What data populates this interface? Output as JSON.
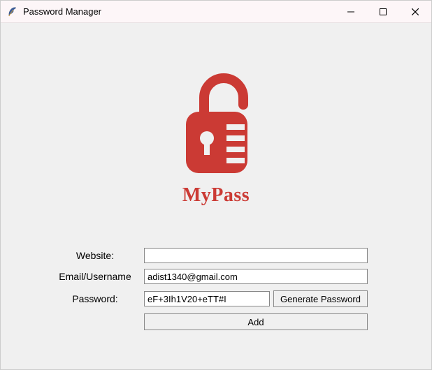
{
  "window": {
    "title": "Password Manager"
  },
  "logo": {
    "brand_text": "MyPass",
    "color": "#cb3a34"
  },
  "form": {
    "website_label": "Website:",
    "website_value": "",
    "email_label": "Email/Username",
    "email_value": "adist1340@gmail.com",
    "password_label": "Password:",
    "password_value": "eF+3Ih1V20+eTT#I",
    "generate_button": "Generate Password",
    "add_button": "Add"
  }
}
